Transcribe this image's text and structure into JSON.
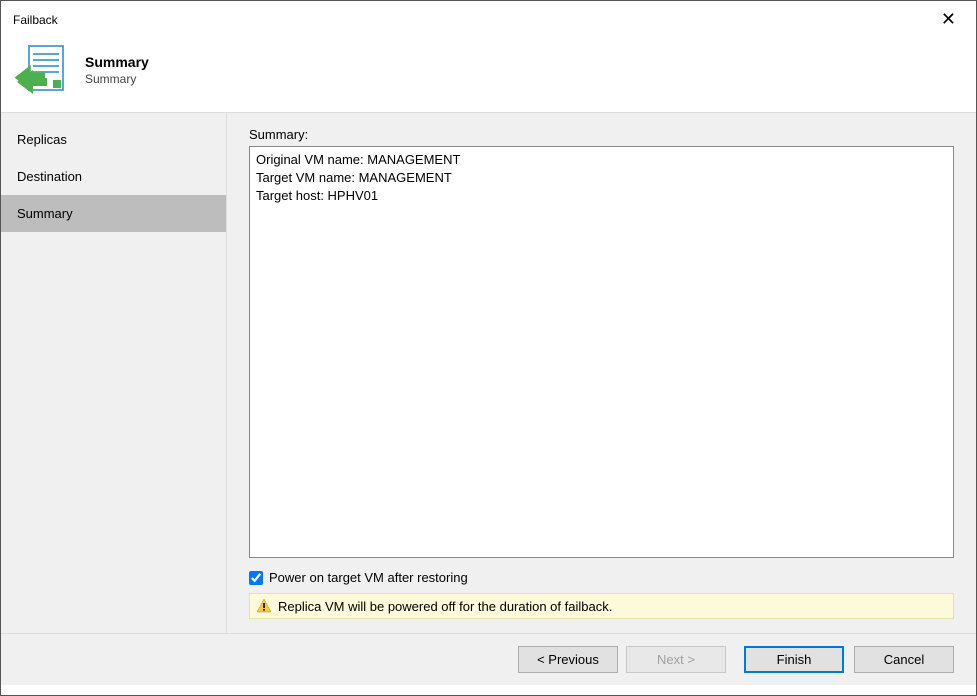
{
  "window": {
    "title": "Failback"
  },
  "header": {
    "title": "Summary",
    "subtitle": "Summary"
  },
  "sidebar": {
    "items": [
      {
        "label": "Replicas",
        "active": false
      },
      {
        "label": "Destination",
        "active": false
      },
      {
        "label": "Summary",
        "active": true
      }
    ]
  },
  "main": {
    "summary_label": "Summary:",
    "summary_text": "Original VM name: MANAGEMENT\nTarget VM name: MANAGEMENT\nTarget host: HPHV01",
    "checkbox_label": "Power on target VM after restoring",
    "checkbox_checked": true,
    "warning_text": "Replica VM will be powered off for the duration of failback."
  },
  "footer": {
    "previous": "< Previous",
    "next": "Next >",
    "finish": "Finish",
    "cancel": "Cancel"
  }
}
